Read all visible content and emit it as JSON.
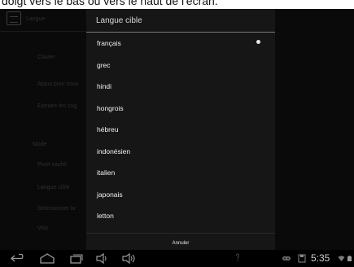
{
  "caption": "doigt vers le bas ou vers le haut de l'écran.",
  "background": {
    "items": [
      "Langue",
      "Clavier",
      "Appui pour sous",
      "Extraire les sug",
      "Mode",
      "Pivot caché",
      "Langue cible",
      "Sélectionner la",
      "Voix"
    ]
  },
  "dialog": {
    "title": "Langue cible",
    "options": [
      {
        "label": "français",
        "selected": true
      },
      {
        "label": "grec",
        "selected": false
      },
      {
        "label": "hindi",
        "selected": false
      },
      {
        "label": "hongrois",
        "selected": false
      },
      {
        "label": "hébreu",
        "selected": false
      },
      {
        "label": "indonésien",
        "selected": false
      },
      {
        "label": "italien",
        "selected": false
      },
      {
        "label": "japonais",
        "selected": false
      },
      {
        "label": "letton",
        "selected": false
      }
    ],
    "cancel_label": "Annuler"
  },
  "navbar": {
    "icons": [
      "back-icon",
      "home-icon",
      "recent-apps-icon",
      "volume-down-icon",
      "volume-up-icon"
    ],
    "status_icons": [
      "notification-icon",
      "gamepad-icon",
      "storage-icon",
      "wifi-icon",
      "battery-icon"
    ],
    "clock": "5:35"
  },
  "colors": {
    "screen_bg": "#0a0a0a",
    "dialog_bg": "#161616",
    "text": "#f2f2f2"
  }
}
